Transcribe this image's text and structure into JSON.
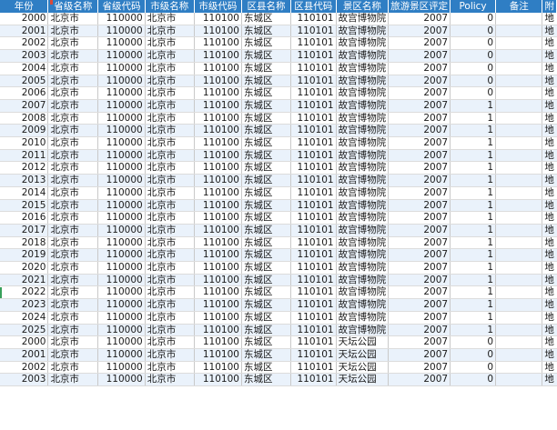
{
  "headers": [
    "年份",
    "省级名称",
    "省级代码",
    "市级名称",
    "市级代码",
    "区县名称",
    "区县代码",
    "景区名称",
    "旅游景区评定",
    "Policy",
    "备注",
    "附"
  ],
  "rows": [
    [
      "2000",
      "北京市",
      "110000",
      "北京市",
      "110100",
      "东城区",
      "110101",
      "故宫博物院",
      "2007",
      "0",
      "",
      "地"
    ],
    [
      "2001",
      "北京市",
      "110000",
      "北京市",
      "110100",
      "东城区",
      "110101",
      "故宫博物院",
      "2007",
      "0",
      "",
      "地"
    ],
    [
      "2002",
      "北京市",
      "110000",
      "北京市",
      "110100",
      "东城区",
      "110101",
      "故宫博物院",
      "2007",
      "0",
      "",
      "地"
    ],
    [
      "2003",
      "北京市",
      "110000",
      "北京市",
      "110100",
      "东城区",
      "110101",
      "故宫博物院",
      "2007",
      "0",
      "",
      "地"
    ],
    [
      "2004",
      "北京市",
      "110000",
      "北京市",
      "110100",
      "东城区",
      "110101",
      "故宫博物院",
      "2007",
      "0",
      "",
      "地"
    ],
    [
      "2005",
      "北京市",
      "110000",
      "北京市",
      "110100",
      "东城区",
      "110101",
      "故宫博物院",
      "2007",
      "0",
      "",
      "地"
    ],
    [
      "2006",
      "北京市",
      "110000",
      "北京市",
      "110100",
      "东城区",
      "110101",
      "故宫博物院",
      "2007",
      "0",
      "",
      "地"
    ],
    [
      "2007",
      "北京市",
      "110000",
      "北京市",
      "110100",
      "东城区",
      "110101",
      "故宫博物院",
      "2007",
      "1",
      "",
      "地"
    ],
    [
      "2008",
      "北京市",
      "110000",
      "北京市",
      "110100",
      "东城区",
      "110101",
      "故宫博物院",
      "2007",
      "1",
      "",
      "地"
    ],
    [
      "2009",
      "北京市",
      "110000",
      "北京市",
      "110100",
      "东城区",
      "110101",
      "故宫博物院",
      "2007",
      "1",
      "",
      "地"
    ],
    [
      "2010",
      "北京市",
      "110000",
      "北京市",
      "110100",
      "东城区",
      "110101",
      "故宫博物院",
      "2007",
      "1",
      "",
      "地"
    ],
    [
      "2011",
      "北京市",
      "110000",
      "北京市",
      "110100",
      "东城区",
      "110101",
      "故宫博物院",
      "2007",
      "1",
      "",
      "地"
    ],
    [
      "2012",
      "北京市",
      "110000",
      "北京市",
      "110100",
      "东城区",
      "110101",
      "故宫博物院",
      "2007",
      "1",
      "",
      "地"
    ],
    [
      "2013",
      "北京市",
      "110000",
      "北京市",
      "110100",
      "东城区",
      "110101",
      "故宫博物院",
      "2007",
      "1",
      "",
      "地"
    ],
    [
      "2014",
      "北京市",
      "110000",
      "北京市",
      "110100",
      "东城区",
      "110101",
      "故宫博物院",
      "2007",
      "1",
      "",
      "地"
    ],
    [
      "2015",
      "北京市",
      "110000",
      "北京市",
      "110100",
      "东城区",
      "110101",
      "故宫博物院",
      "2007",
      "1",
      "",
      "地"
    ],
    [
      "2016",
      "北京市",
      "110000",
      "北京市",
      "110100",
      "东城区",
      "110101",
      "故宫博物院",
      "2007",
      "1",
      "",
      "地"
    ],
    [
      "2017",
      "北京市",
      "110000",
      "北京市",
      "110100",
      "东城区",
      "110101",
      "故宫博物院",
      "2007",
      "1",
      "",
      "地"
    ],
    [
      "2018",
      "北京市",
      "110000",
      "北京市",
      "110100",
      "东城区",
      "110101",
      "故宫博物院",
      "2007",
      "1",
      "",
      "地"
    ],
    [
      "2019",
      "北京市",
      "110000",
      "北京市",
      "110100",
      "东城区",
      "110101",
      "故宫博物院",
      "2007",
      "1",
      "",
      "地"
    ],
    [
      "2020",
      "北京市",
      "110000",
      "北京市",
      "110100",
      "东城区",
      "110101",
      "故宫博物院",
      "2007",
      "1",
      "",
      "地"
    ],
    [
      "2021",
      "北京市",
      "110000",
      "北京市",
      "110100",
      "东城区",
      "110101",
      "故宫博物院",
      "2007",
      "1",
      "",
      "地"
    ],
    [
      "2022",
      "北京市",
      "110000",
      "北京市",
      "110100",
      "东城区",
      "110101",
      "故宫博物院",
      "2007",
      "1",
      "",
      "地"
    ],
    [
      "2023",
      "北京市",
      "110000",
      "北京市",
      "110100",
      "东城区",
      "110101",
      "故宫博物院",
      "2007",
      "1",
      "",
      "地"
    ],
    [
      "2024",
      "北京市",
      "110000",
      "北京市",
      "110100",
      "东城区",
      "110101",
      "故宫博物院",
      "2007",
      "1",
      "",
      "地"
    ],
    [
      "2025",
      "北京市",
      "110000",
      "北京市",
      "110100",
      "东城区",
      "110101",
      "故宫博物院",
      "2007",
      "1",
      "",
      "地"
    ],
    [
      "2000",
      "北京市",
      "110000",
      "北京市",
      "110100",
      "东城区",
      "110101",
      "天坛公园",
      "2007",
      "0",
      "",
      "地"
    ],
    [
      "2001",
      "北京市",
      "110000",
      "北京市",
      "110100",
      "东城区",
      "110101",
      "天坛公园",
      "2007",
      "0",
      "",
      "地"
    ],
    [
      "2002",
      "北京市",
      "110000",
      "北京市",
      "110100",
      "东城区",
      "110101",
      "天坛公园",
      "2007",
      "0",
      "",
      "地"
    ],
    [
      "2003",
      "北京市",
      "110000",
      "北京市",
      "110100",
      "东城区",
      "110101",
      "天坛公园",
      "2007",
      "0",
      "",
      "地"
    ]
  ],
  "colors": {
    "header": "#2f7ec4",
    "alt_row": "#eaf2fb"
  }
}
